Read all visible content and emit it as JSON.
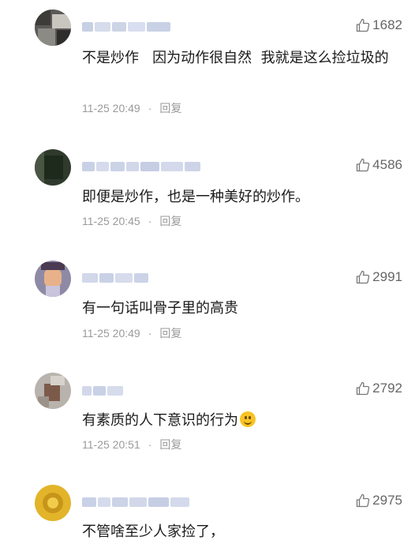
{
  "comments": [
    {
      "text": "不是炒作   因为动作很自然  我就是这么捡垃圾的",
      "time": "11-25 20:49",
      "reply": "回复",
      "likes": "1682"
    },
    {
      "text": "即便是炒作，也是一种美好的炒作。",
      "time": "11-25 20:45",
      "reply": "回复",
      "likes": "4586"
    },
    {
      "text": "有一句话叫骨子里的高贵",
      "time": "11-25 20:49",
      "reply": "回复",
      "likes": "2991"
    },
    {
      "text": "有素质的人下意识的行为",
      "time": "11-25 20:51",
      "reply": "回复",
      "likes": "2792",
      "emoji": "smile-emoji"
    },
    {
      "text": "不管啥至少人家捡了，",
      "likes": "2975"
    }
  ],
  "colors": {
    "text": "#1a1a1a",
    "meta": "#9a9a9a",
    "likes": "#666666"
  }
}
